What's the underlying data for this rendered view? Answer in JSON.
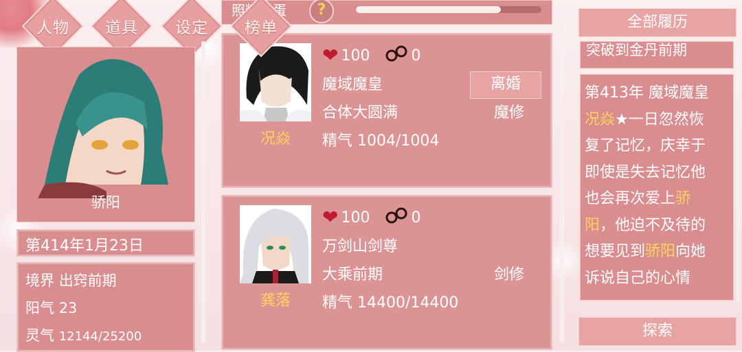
{
  "nav": [
    "人物",
    "道具",
    "设定",
    "榜单"
  ],
  "player": {
    "name": "骄阳",
    "date": "第414年1月23日",
    "stats": [
      {
        "label": "境界",
        "value": "出窍前期"
      },
      {
        "label": "阳气",
        "value": "23"
      },
      {
        "label": "灵气",
        "value": "12144/25200"
      }
    ]
  },
  "egg": {
    "title": "照料灵蛋",
    "help": "?",
    "progress": 0.78
  },
  "cards": [
    {
      "name": "况焱",
      "hearts": "100",
      "cuffs": "0",
      "title": "魔域魔皇",
      "realm": "合体大圆满",
      "sect": "魔修",
      "essence": "精气 1004/1004",
      "button": "离婚"
    },
    {
      "name": "龚落",
      "hearts": "100",
      "cuffs": "0",
      "title": "万剑山剑尊",
      "realm": "大乘前期",
      "sect": "剑修",
      "essence": "精气 14400/14400"
    }
  ],
  "history": {
    "all_label": "全部履历",
    "snippet": "突破到金丹前期",
    "entry_parts": [
      "第413年 魔域魔皇",
      "况焱",
      "★一日忽然恢复了记忆，庆幸于即使是失去记忆他也会再次爱上",
      "骄阳",
      "，他迫不及待的想要见到",
      "骄阳",
      "向她诉说自己的心情"
    ]
  },
  "explore_label": "探索",
  "colors": {
    "panel": "#d98d8e",
    "highlight": "#ffd45c",
    "heart": "#c11b2e"
  }
}
